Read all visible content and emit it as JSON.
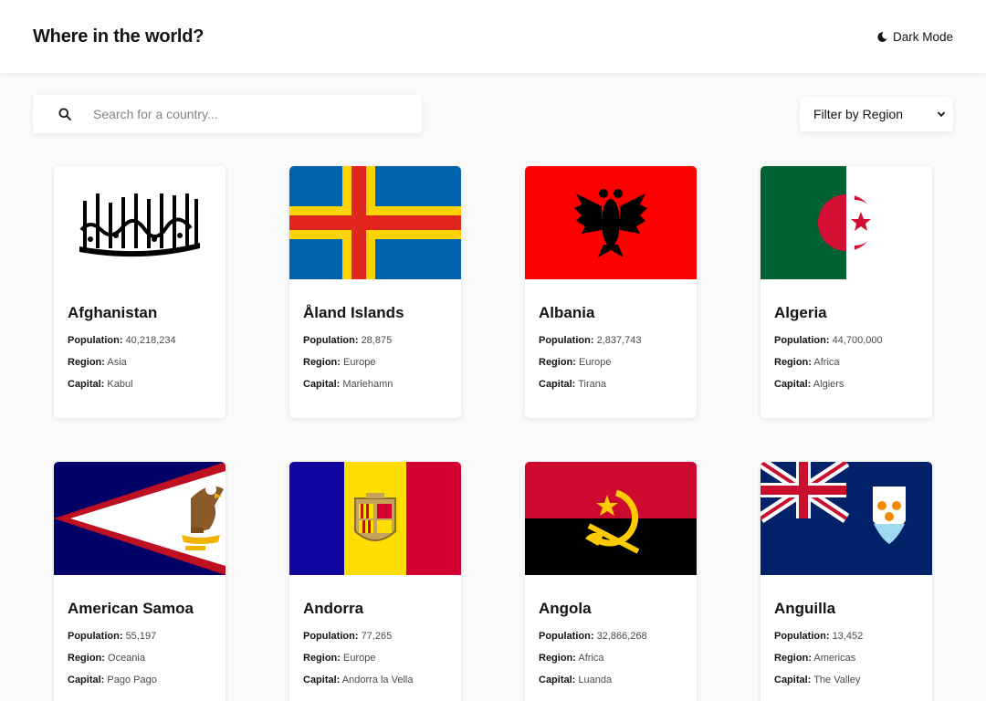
{
  "header": {
    "title": "Where in the world?",
    "dark_mode_label": "Dark Mode"
  },
  "search": {
    "placeholder": "Search for a country..."
  },
  "filter": {
    "label": "Filter by Region"
  },
  "labels": {
    "population": "Population:",
    "region": "Region:",
    "capital": "Capital:"
  },
  "countries": [
    {
      "name": "Afghanistan",
      "population": "40,218,234",
      "region": "Asia",
      "capital": "Kabul"
    },
    {
      "name": "Åland Islands",
      "population": "28,875",
      "region": "Europe",
      "capital": "Mariehamn"
    },
    {
      "name": "Albania",
      "population": "2,837,743",
      "region": "Europe",
      "capital": "Tirana"
    },
    {
      "name": "Algeria",
      "population": "44,700,000",
      "region": "Africa",
      "capital": "Algiers"
    },
    {
      "name": "American Samoa",
      "population": "55,197",
      "region": "Oceania",
      "capital": "Pago Pago"
    },
    {
      "name": "Andorra",
      "population": "77,265",
      "region": "Europe",
      "capital": "Andorra la Vella"
    },
    {
      "name": "Angola",
      "population": "32,866,268",
      "region": "Africa",
      "capital": "Luanda"
    },
    {
      "name": "Anguilla",
      "population": "13,452",
      "region": "Americas",
      "capital": "The Valley"
    }
  ],
  "colors": {
    "background": "#fafafa",
    "surface": "#ffffff",
    "text": "#111517",
    "placeholder": "#848484"
  }
}
